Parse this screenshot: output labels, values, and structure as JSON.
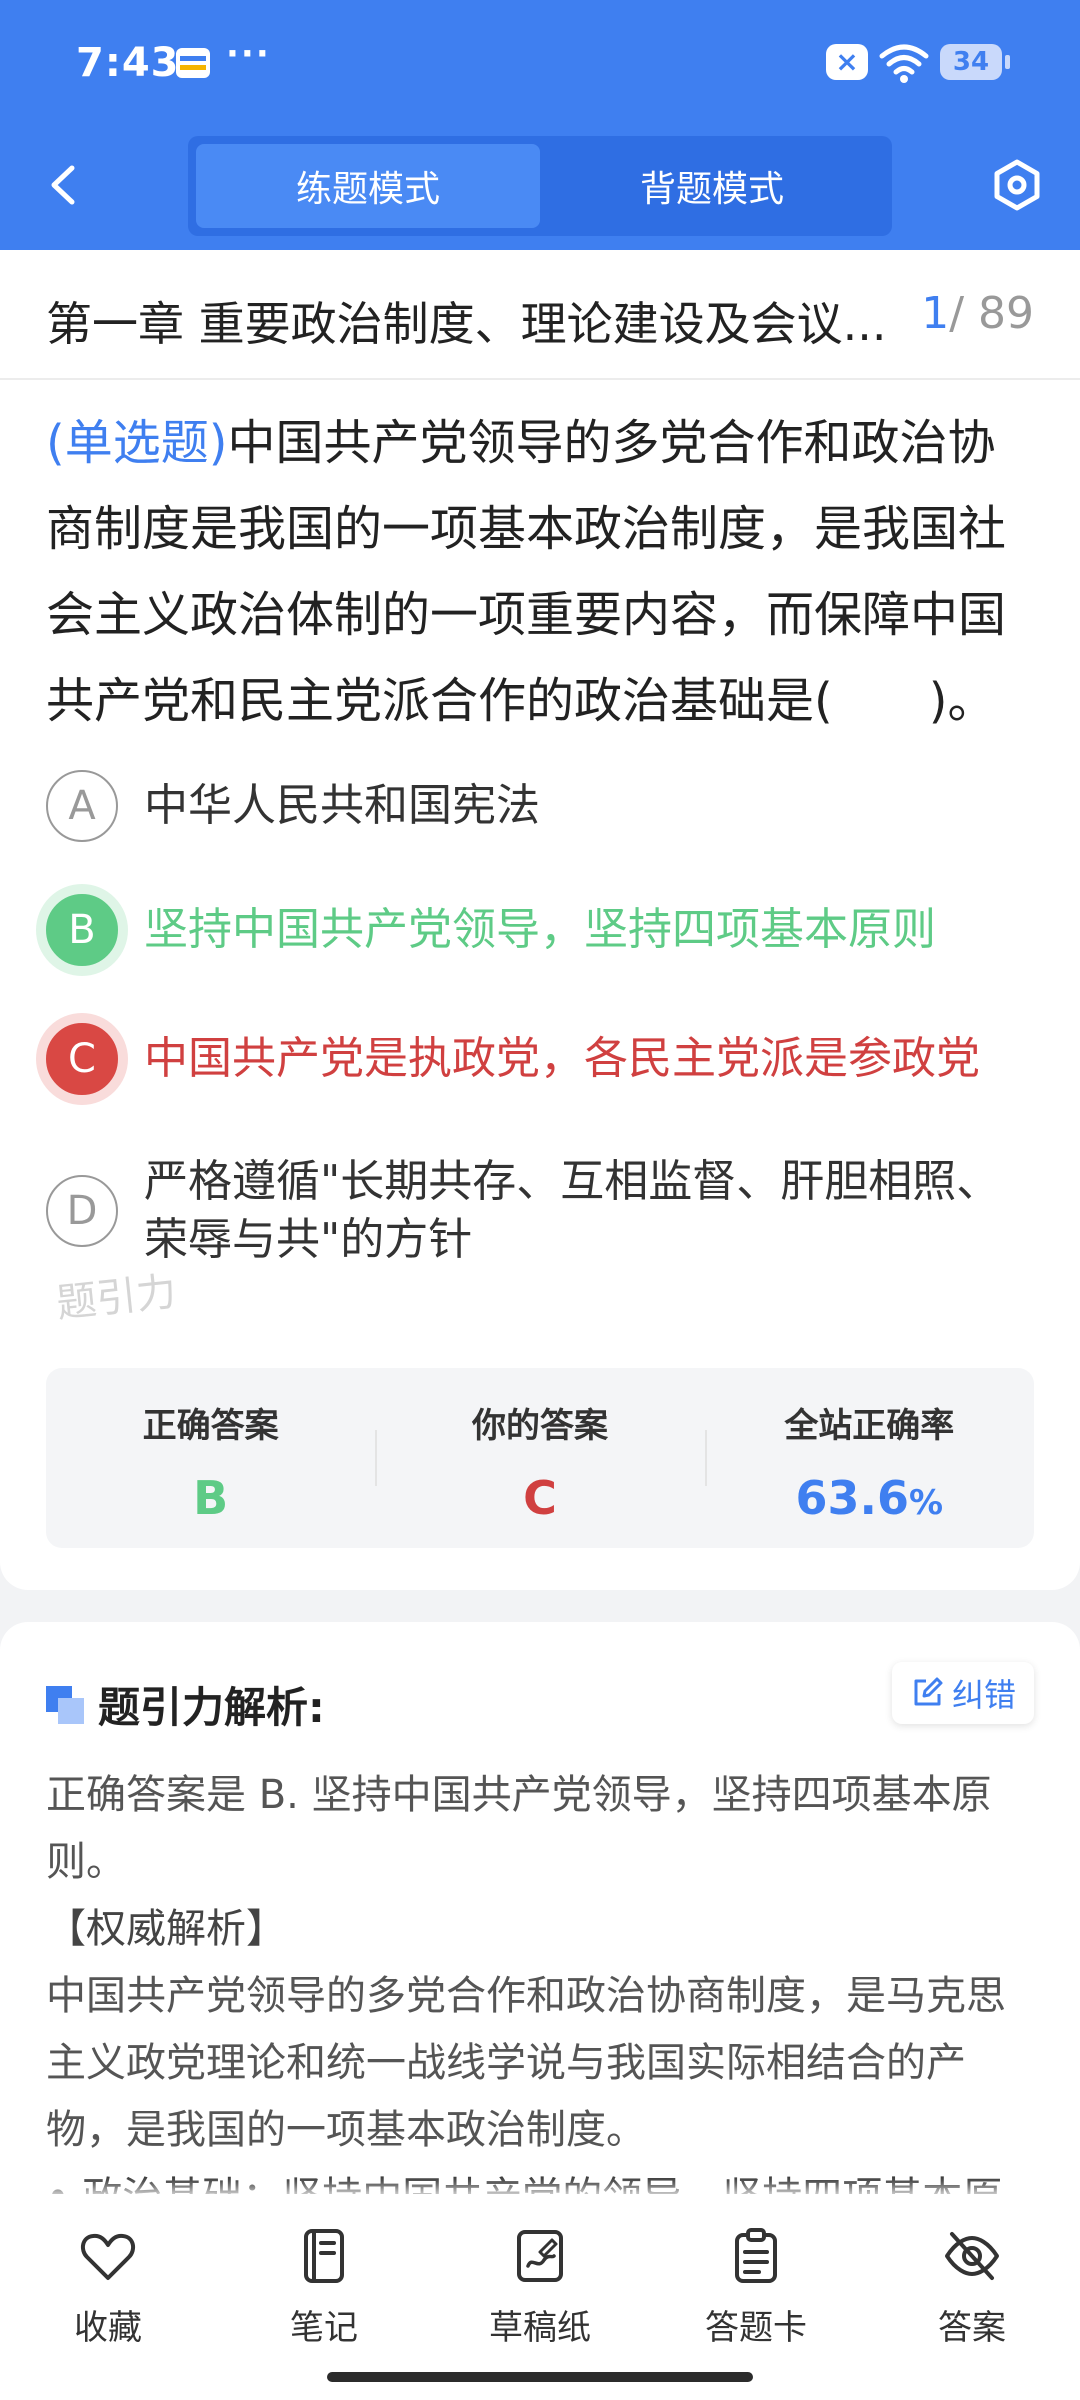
{
  "status_bar": {
    "time": "7:43",
    "dots": "···",
    "battery": "34"
  },
  "header": {
    "tabs": [
      {
        "label": "练题模式",
        "active": true
      },
      {
        "label": "背题模式",
        "active": false
      }
    ]
  },
  "chapter": {
    "title": "第一章 重要政治制度、理论建设及会议...",
    "current": "1",
    "total": "/ 89"
  },
  "question": {
    "type": "(单选题)",
    "text": "中国共产党领导的多党合作和政治协商制度是我国的一项基本政治制度，是我国社会主义政治体制的一项重要内容，而保障中国共产党和民主党派合作的政治基础是(　　)。"
  },
  "options": [
    {
      "letter": "A",
      "text": "中华人民共和国宪法",
      "state": "normal"
    },
    {
      "letter": "B",
      "text": "坚持中国共产党领导，坚持四项基本原则",
      "state": "correct"
    },
    {
      "letter": "C",
      "text": "中国共产党是执政党，各民主党派是参政党",
      "state": "wrong"
    },
    {
      "letter": "D",
      "text": "严格遵循\"长期共存、互相监督、肝胆相照、荣辱与共\"的方针",
      "state": "normal"
    }
  ],
  "watermark": "题引力",
  "stats": {
    "correct_label": "正确答案",
    "correct_value": "B",
    "yours_label": "你的答案",
    "yours_value": "C",
    "rate_label": "全站正确率",
    "rate_value": "63.6",
    "rate_unit": "%"
  },
  "analysis": {
    "title": "题引力解析:",
    "report_label": "纠错",
    "answer_line": "正确答案是 B. 坚持中国共产党领导，坚持四项基本原则。",
    "auth_title": "【权威解析】",
    "body": "中国共产党领导的多党合作和政治协商制度，是马克思主义政党理论和统一战线学说与我国实际相结合的产物，是我国的一项基本政治制度。",
    "cut_line": "• 政治基础：坚持中国共产党的领导，坚持四项基本原"
  },
  "bottom_nav": [
    {
      "label": "收藏",
      "icon": "heart-icon"
    },
    {
      "label": "笔记",
      "icon": "notebook-icon"
    },
    {
      "label": "草稿纸",
      "icon": "draft-icon"
    },
    {
      "label": "答题卡",
      "icon": "answer-card-icon"
    },
    {
      "label": "答案",
      "icon": "eye-off-icon"
    }
  ],
  "colors": {
    "primary": "#3f7ff0",
    "correct": "#5ecb86",
    "wrong": "#d94844"
  }
}
